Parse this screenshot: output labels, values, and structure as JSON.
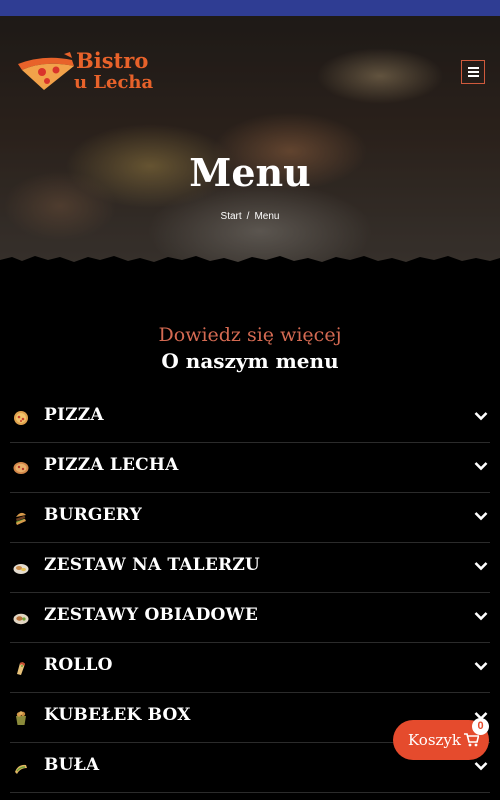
{
  "header": {
    "logo_line1": "Bistro",
    "logo_line2": "u Lecha",
    "menu_toggle_icon": "hamburger-icon"
  },
  "hero": {
    "title": "Menu",
    "breadcrumb": [
      "Start",
      "Menu"
    ],
    "breadcrumb_separator": "/"
  },
  "section": {
    "subtitle": "Dowiedz się więcej",
    "title": "O naszym menu"
  },
  "categories": [
    {
      "label": "PIZZA",
      "icon": "pizza-icon"
    },
    {
      "label": "PIZZA LECHA",
      "icon": "pizza-icon"
    },
    {
      "label": "BURGERY",
      "icon": "burger-icon"
    },
    {
      "label": "ZESTAW NA TALERZU",
      "icon": "plate-icon"
    },
    {
      "label": "ZESTAWY OBIADOWE",
      "icon": "dinner-icon"
    },
    {
      "label": "ROLLO",
      "icon": "wrap-icon"
    },
    {
      "label": "KUBEŁEK BOX",
      "icon": "bucket-icon"
    },
    {
      "label": "BUŁA",
      "icon": "bun-icon"
    }
  ],
  "cart": {
    "label": "Koszyk",
    "count": "0",
    "icon": "cart-icon"
  },
  "colors": {
    "top_bar": "#2f3d93",
    "accent": "#e54b2d",
    "subtitle": "#d46a52",
    "background": "#000000"
  }
}
